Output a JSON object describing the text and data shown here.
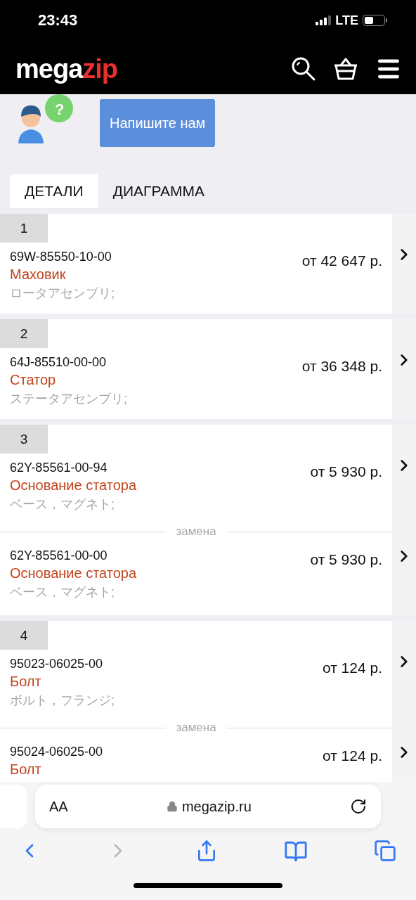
{
  "status_bar": {
    "time": "23:43",
    "network": "LTE"
  },
  "header": {
    "logo_main": "mega",
    "logo_accent": "zip"
  },
  "help": {
    "badge": "?",
    "button": "Напишите нам"
  },
  "tabs": [
    {
      "label": "ДЕТАЛИ",
      "selected": true
    },
    {
      "label": "ДИАГРАММА",
      "selected": false
    }
  ],
  "groups": [
    {
      "number": "1",
      "items": [
        {
          "part_number": "69W-85550-10-00",
          "name": "Маховик",
          "description": "ロータアセンブリ;",
          "price": "от 42 647 р."
        }
      ]
    },
    {
      "number": "2",
      "items": [
        {
          "part_number": "64J-85510-00-00",
          "name": "Статор",
          "description": "ステータアセンブリ;",
          "price": "от 36 348 р."
        }
      ]
    },
    {
      "number": "3",
      "items": [
        {
          "part_number": "62Y-85561-00-94",
          "name": "Основание статора",
          "description": "ベース，マグネト;",
          "price": "от 5 930 р."
        },
        {
          "divider_label": "замена",
          "part_number": "62Y-85561-00-00",
          "name": "Основание статора",
          "description": "ベース，マグネト;",
          "price": "от 5 930 р."
        }
      ]
    },
    {
      "number": "4",
      "items": [
        {
          "part_number": "95023-06025-00",
          "name": "Болт",
          "description": "ボルト，フランジ;",
          "price": "от 124 р."
        },
        {
          "divider_label": "замена",
          "part_number": "95024-06025-00",
          "name": "Болт",
          "price": "от 124 р."
        }
      ]
    }
  ],
  "browser": {
    "text_size": "AA",
    "url": "megazip.ru",
    "back_disabled": false,
    "forward_disabled": true
  }
}
